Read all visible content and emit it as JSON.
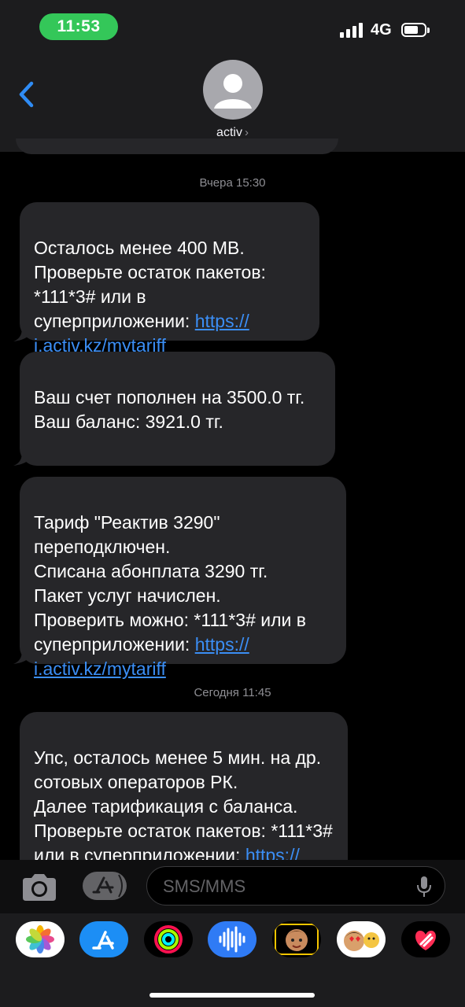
{
  "status": {
    "time": "11:53",
    "network": "4G"
  },
  "header": {
    "contact": "activ",
    "chevron": "›"
  },
  "timestamps": [
    {
      "day": "Вчера",
      "time": "15:30"
    },
    {
      "day": "Сегодня",
      "time": "11:45"
    }
  ],
  "messages": [
    {
      "text": "Осталось менее 400 MB.\nПроверьте остаток пакетов: *111*3# или в суперприложении: ",
      "link": "https://\ni.activ.kz/mytariff"
    },
    {
      "text": "Ваш счет пополнен на 3500.0 тг.\nВаш баланс: 3921.0 тг.",
      "link": ""
    },
    {
      "text": "Тариф \"Реактив 3290\" переподключен.\nСписана абонплата 3290 тг.\nПакет услуг начислен.\nПроверить можно: *111*3# или в суперприложении: ",
      "link": "https://\ni.activ.kz/mytariff"
    },
    {
      "text": "Упс, осталось менее 5 мин. на др. сотовых операторов РК.\nДалее тарификация с баланса.\nПроверьте остаток пакетов: *111*3# или в суперприложении: ",
      "link": "https://"
    }
  ],
  "input": {
    "placeholder": "SMS/MMS"
  },
  "apps": [
    "photos-icon",
    "app-store-icon",
    "activity-icon",
    "voice-memo-icon",
    "memoji-icon",
    "memoji-stickers-icon",
    "digital-touch-icon"
  ]
}
